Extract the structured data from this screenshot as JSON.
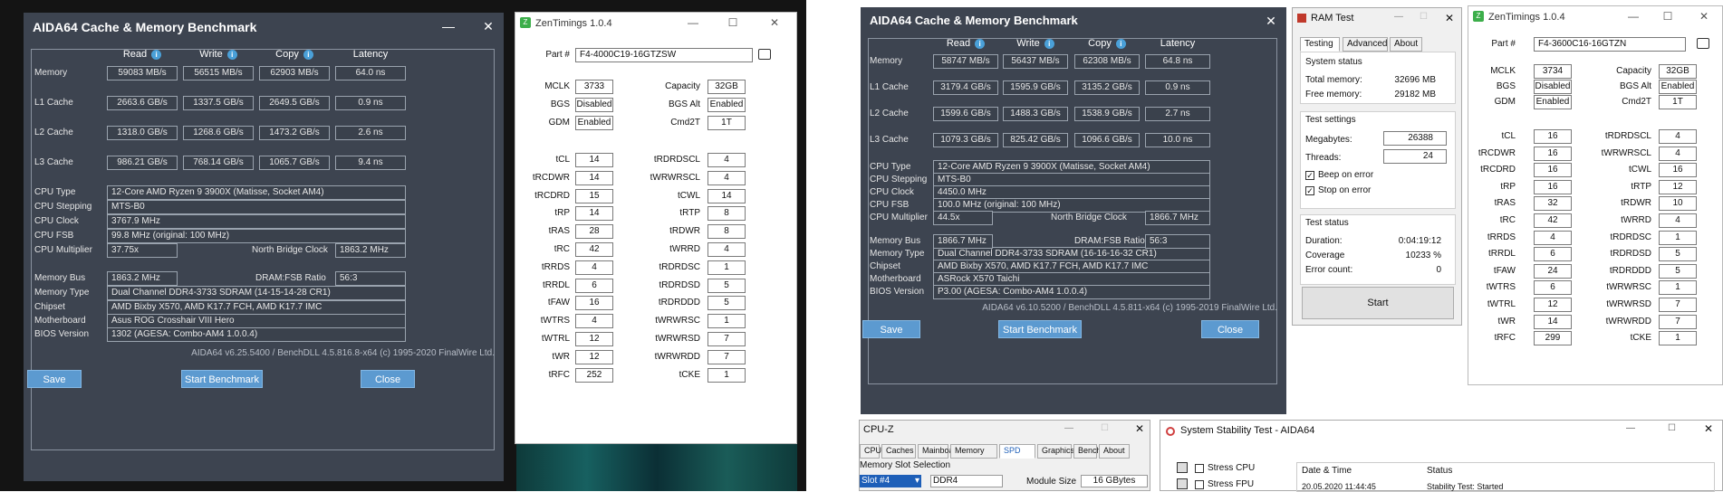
{
  "aida1": {
    "title": "AIDA64 Cache & Memory Benchmark",
    "headers": [
      "Read",
      "Write",
      "Copy",
      "Latency"
    ],
    "rows": [
      {
        "label": "Memory",
        "vals": [
          "59083 MB/s",
          "56515 MB/s",
          "62903 MB/s",
          "64.0 ns"
        ]
      },
      {
        "label": "L1 Cache",
        "vals": [
          "2663.6 GB/s",
          "1337.5 GB/s",
          "2649.5 GB/s",
          "0.9 ns"
        ]
      },
      {
        "label": "L2 Cache",
        "vals": [
          "1318.0 GB/s",
          "1268.6 GB/s",
          "1473.2 GB/s",
          "2.6 ns"
        ]
      },
      {
        "label": "L3 Cache",
        "vals": [
          "986.21 GB/s",
          "768.14 GB/s",
          "1065.7 GB/s",
          "9.4 ns"
        ]
      }
    ],
    "cpu_type_label": "CPU Type",
    "cpu_type": "12-Core AMD Ryzen 9 3900X  (Matisse, Socket AM4)",
    "cpu_stepping_label": "CPU Stepping",
    "cpu_stepping": "MTS-B0",
    "cpu_clock_label": "CPU Clock",
    "cpu_clock": "3767.9 MHz",
    "cpu_fsb_label": "CPU FSB",
    "cpu_fsb": "99.8 MHz  (original: 100 MHz)",
    "cpu_mult_label": "CPU Multiplier",
    "cpu_mult": "37.75x",
    "nb_clock_label": "North Bridge Clock",
    "nb_clock": "1863.2 MHz",
    "mem_bus_label": "Memory Bus",
    "mem_bus": "1863.2 MHz",
    "dram_ratio_label": "DRAM:FSB Ratio",
    "dram_ratio": "56:3",
    "mem_type_label": "Memory Type",
    "mem_type": "Dual Channel DDR4-3733 SDRAM  (14-15-14-28 CR1)",
    "chipset_label": "Chipset",
    "chipset": "AMD Bixby X570, AMD K17.7 FCH, AMD K17.7 IMC",
    "mobo_label": "Motherboard",
    "mobo": "Asus ROG Crosshair VIII Hero",
    "bios_label": "BIOS Version",
    "bios": "1302  (AGESA: Combo-AM4 1.0.0.4)",
    "footer": "AIDA64 v6.25.5400 / BenchDLL 4.5.816.8-x64  (c) 1995-2020 FinalWire Ltd.",
    "save": "Save",
    "start": "Start Benchmark",
    "close": "Close"
  },
  "zen1": {
    "title": "ZenTimings 1.0.4",
    "part_label": "Part #",
    "part": "F4-4000C19-16GTZSW",
    "mclk_label": "MCLK",
    "mclk": "3733",
    "cap_label": "Capacity",
    "cap": "32GB",
    "bgs_label": "BGS",
    "bgs": "Disabled",
    "bgsalt_label": "BGS Alt",
    "bgsalt": "Enabled",
    "gdm_label": "GDM",
    "gdm": "Enabled",
    "cmd2t_label": "Cmd2T",
    "cmd2t": "1T",
    "timings": [
      [
        "tCL",
        "14",
        "tRDRDSCL",
        "4"
      ],
      [
        "tRCDWR",
        "14",
        "tWRWRSCL",
        "4"
      ],
      [
        "tRCDRD",
        "15",
        "tCWL",
        "14"
      ],
      [
        "tRP",
        "14",
        "tRTP",
        "8"
      ],
      [
        "tRAS",
        "28",
        "tRDWR",
        "8"
      ],
      [
        "tRC",
        "42",
        "tWRRD",
        "4"
      ],
      [
        "tRRDS",
        "4",
        "tRDRDSC",
        "1"
      ],
      [
        "tRRDL",
        "6",
        "tRDRDSD",
        "5"
      ],
      [
        "tFAW",
        "16",
        "tRDRDDD",
        "5"
      ],
      [
        "tWTRS",
        "4",
        "tWRWRSC",
        "1"
      ],
      [
        "tWTRL",
        "12",
        "tWRWRSD",
        "7"
      ],
      [
        "tWR",
        "12",
        "tWRWRDD",
        "7"
      ],
      [
        "tRFC",
        "252",
        "tCKE",
        "1"
      ]
    ]
  },
  "aida2": {
    "title": "AIDA64 Cache & Memory Benchmark",
    "headers": [
      "Read",
      "Write",
      "Copy",
      "Latency"
    ],
    "rows": [
      {
        "label": "Memory",
        "vals": [
          "58747 MB/s",
          "56437 MB/s",
          "62308 MB/s",
          "64.8 ns"
        ]
      },
      {
        "label": "L1 Cache",
        "vals": [
          "3179.4 GB/s",
          "1595.9 GB/s",
          "3135.2 GB/s",
          "0.9 ns"
        ]
      },
      {
        "label": "L2 Cache",
        "vals": [
          "1599.6 GB/s",
          "1488.3 GB/s",
          "1538.9 GB/s",
          "2.7 ns"
        ]
      },
      {
        "label": "L3 Cache",
        "vals": [
          "1079.3 GB/s",
          "825.42 GB/s",
          "1096.6 GB/s",
          "10.0 ns"
        ]
      }
    ],
    "cpu_type_label": "CPU Type",
    "cpu_type": "12-Core AMD Ryzen 9 3900X  (Matisse, Socket AM4)",
    "cpu_stepping_label": "CPU Stepping",
    "cpu_stepping": "MTS-B0",
    "cpu_clock_label": "CPU Clock",
    "cpu_clock": "4450.0 MHz",
    "cpu_fsb_label": "CPU FSB",
    "cpu_fsb": "100.0 MHz  (original: 100 MHz)",
    "cpu_mult_label": "CPU Multiplier",
    "cpu_mult": "44.5x",
    "nb_clock_label": "North Bridge Clock",
    "nb_clock": "1866.7 MHz",
    "mem_bus_label": "Memory Bus",
    "mem_bus": "1866.7 MHz",
    "dram_ratio_label": "DRAM:FSB Ratio",
    "dram_ratio": "56:3",
    "mem_type_label": "Memory Type",
    "mem_type": "Dual Channel DDR4-3733 SDRAM  (16-16-16-32 CR1)",
    "chipset_label": "Chipset",
    "chipset": "AMD Bixby X570, AMD K17.7 FCH, AMD K17.7 IMC",
    "mobo_label": "Motherboard",
    "mobo": "ASRock X570 Taichi",
    "bios_label": "BIOS Version",
    "bios": "P3.00  (AGESA: Combo-AM4 1.0.0.4)",
    "footer": "AIDA64 v6.10.5200 / BenchDLL 4.5.811-x64  (c) 1995-2019 FinalWire Ltd.",
    "save": "Save",
    "start": "Start Benchmark",
    "close": "Close"
  },
  "ramtest": {
    "title": "RAM Test",
    "tabs": [
      "Testing",
      "Advanced",
      "About"
    ],
    "status_group": "System status",
    "total_label": "Total memory:",
    "total": "32696 MB",
    "free_label": "Free memory:",
    "free": "29182 MB",
    "settings_group": "Test settings",
    "mb_label": "Megabytes:",
    "mb": "26388",
    "threads_label": "Threads:",
    "threads": "24",
    "beep_label": "Beep on error",
    "stop_label": "Stop on error",
    "test_status_group": "Test status",
    "duration_label": "Duration:",
    "duration": "0:04:19:12",
    "coverage_label": "Coverage",
    "coverage": "10233 %",
    "errors_label": "Error count:",
    "errors": "0",
    "start": "Start"
  },
  "zen2": {
    "title": "ZenTimings 1.0.4",
    "part_label": "Part #",
    "part": "F4-3600C16-16GTZN",
    "mclk_label": "MCLK",
    "mclk": "3734",
    "cap_label": "Capacity",
    "cap": "32GB",
    "bgs_label": "BGS",
    "bgs": "Disabled",
    "bgsalt_label": "BGS Alt",
    "bgsalt": "Enabled",
    "gdm_label": "GDM",
    "gdm": "Enabled",
    "cmd2t_label": "Cmd2T",
    "cmd2t": "1T",
    "timings": [
      [
        "tCL",
        "16",
        "tRDRDSCL",
        "4"
      ],
      [
        "tRCDWR",
        "16",
        "tWRWRSCL",
        "4"
      ],
      [
        "tRCDRD",
        "16",
        "tCWL",
        "16"
      ],
      [
        "tRP",
        "16",
        "tRTP",
        "12"
      ],
      [
        "tRAS",
        "32",
        "tRDWR",
        "10"
      ],
      [
        "tRC",
        "42",
        "tWRRD",
        "4"
      ],
      [
        "tRRDS",
        "4",
        "tRDRDSC",
        "1"
      ],
      [
        "tRRDL",
        "6",
        "tRDRDSD",
        "5"
      ],
      [
        "tFAW",
        "24",
        "tRDRDDD",
        "5"
      ],
      [
        "tWTRS",
        "6",
        "tWRWRSC",
        "1"
      ],
      [
        "tWTRL",
        "12",
        "tWRWRSD",
        "7"
      ],
      [
        "tWR",
        "14",
        "tWRWRDD",
        "7"
      ],
      [
        "tRFC",
        "299",
        "tCKE",
        "1"
      ]
    ]
  },
  "cpuz": {
    "title": "CPU-Z",
    "tabs": [
      "CPU",
      "Caches",
      "Mainboard",
      "Memory",
      "SPD",
      "Graphics",
      "Bench",
      "About"
    ],
    "group": "Memory Slot Selection",
    "slot": "Slot #4",
    "type": "DDR4",
    "module_size_label": "Module Size",
    "module_size": "16 GBytes"
  },
  "stability": {
    "title": "System Stability Test - AIDA64",
    "stress_cpu": "Stress CPU",
    "stress_fpu": "Stress FPU",
    "col_date": "Date & Time",
    "col_status": "Status",
    "row_date": "20.05.2020 11:44:45",
    "row_status": "Stability Test: Started"
  }
}
